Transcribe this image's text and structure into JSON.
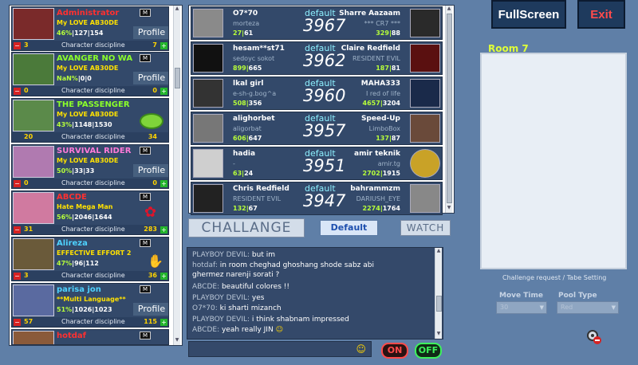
{
  "players": [
    {
      "name": "Administrator",
      "name_color": "#ff3030",
      "subtitle": "My LOVE AB30DE",
      "percent": "46%",
      "wins": "127",
      "total": "154",
      "level": "3",
      "discipline_label": "Character discipline",
      "discipline": "7",
      "profile_label": "Profile",
      "badge": "M"
    },
    {
      "name": "AVANGER NO WA",
      "name_color": "#8bff2a",
      "subtitle": "My LOVE AB30DE",
      "percent": "NaN%",
      "wins": "0",
      "total": "0",
      "level": "0",
      "discipline_label": "Character discipline",
      "discipline": "0",
      "profile_label": "Profile",
      "badge": "M"
    },
    {
      "name": "THE PASSENGER",
      "name_color": "#8bff2a",
      "subtitle": "My LOVE AB30DE",
      "percent": "43%",
      "wins": "1148",
      "total": "1530",
      "level": "20",
      "discipline_label": "Character discipline",
      "discipline": "34",
      "profile_label": "",
      "badge": ""
    },
    {
      "name": "SURVIVAL RIDER",
      "name_color": "#ff7ad9",
      "subtitle": "My LOVE AB30DE",
      "percent": "50%",
      "wins": "33",
      "total": "33",
      "level": "0",
      "discipline_label": "Character discipline",
      "discipline": "0",
      "profile_label": "Profile",
      "badge": "M"
    },
    {
      "name": "ABCDE",
      "name_color": "#ff3030",
      "subtitle": "Hate Mega Man",
      "percent": "56%",
      "wins": "2046",
      "total": "1644",
      "level": "31",
      "discipline_label": "Character discipline",
      "discipline": "283",
      "profile_label": "",
      "badge": "M"
    },
    {
      "name": "Alireza",
      "name_color": "#4fd2ff",
      "subtitle": "EFFECTIVE EFFORT 2",
      "percent": "47%",
      "wins": "96",
      "total": "112",
      "level": "3",
      "discipline_label": "Character discipline",
      "discipline": "36",
      "profile_label": "",
      "badge": "M"
    },
    {
      "name": "parisa jon",
      "name_color": "#4fd2ff",
      "subtitle": "**Multi Language**",
      "percent": "51%",
      "wins": "1026",
      "total": "1023",
      "level": "57",
      "discipline_label": "Character discipline",
      "discipline": "115",
      "profile_label": "Profile",
      "badge": "M"
    },
    {
      "name": "hotdaf",
      "name_color": "#ff3030",
      "subtitle": "",
      "percent": "",
      "wins": "",
      "total": "",
      "level": "",
      "discipline_label": "",
      "discipline": "",
      "profile_label": "",
      "badge": "M"
    }
  ],
  "tables": [
    {
      "a_name": "O7*70",
      "a_sub": "morteza",
      "a_w": "27",
      "a_t": "61",
      "mode": "default",
      "code": "3967",
      "b_name": "Sharre Aazaam",
      "b_sub": "*** CR7 ***",
      "b_w": "329",
      "b_t": "88"
    },
    {
      "a_name": "hesam**st71",
      "a_sub": "sedoyc sokot",
      "a_w": "899",
      "a_t": "665",
      "mode": "default",
      "code": "3962",
      "b_name": "Claire Redfield",
      "b_sub": "RESIDENT EVIL",
      "b_w": "187",
      "b_t": "81"
    },
    {
      "a_name": "lkal girl",
      "a_sub": "e-sh-g.bog^a",
      "a_w": "508",
      "a_t": "356",
      "mode": "default",
      "code": "3960",
      "b_name": "MAHA333",
      "b_sub": "I red of life",
      "b_w": "4657",
      "b_t": "3204"
    },
    {
      "a_name": "alighorbet",
      "a_sub": "aligorbat",
      "a_w": "606",
      "a_t": "647",
      "mode": "default",
      "code": "3957",
      "b_name": "Speed-Up",
      "b_sub": "LimboBox",
      "b_w": "137",
      "b_t": "87"
    },
    {
      "a_name": "hadia",
      "a_sub": "-",
      "a_w": "63",
      "a_t": "24",
      "mode": "default",
      "code": "3951",
      "b_name": "amir teknik",
      "b_sub": "amir.tg",
      "b_w": "2702",
      "b_t": "1915"
    },
    {
      "a_name": "Chris Redfield",
      "a_sub": "RESIDENT EVIL",
      "a_w": "132",
      "a_t": "67",
      "mode": "default",
      "code": "3947",
      "b_name": "bahrammzm",
      "b_sub": "DARIUSH_EYE",
      "b_w": "2274",
      "b_t": "1764"
    }
  ],
  "buttons": {
    "challenge": "CHALLANGE",
    "default": "Default",
    "watch": "WATCH",
    "fullscreen": "FullScreen",
    "exit": "Exit",
    "on": "ON",
    "off": "OFF"
  },
  "chat": [
    {
      "who": "PLAYBOY DEVIL:",
      "msg": " but im"
    },
    {
      "who": "hotdaf:",
      "msg": " in room cheghad ghoshang shode sabz abi"
    },
    {
      "who": "",
      "msg": "ghermez narenji sorati ?"
    },
    {
      "who": "ABCDE:",
      "msg": " beautiful colores !!"
    },
    {
      "who": "PLAYBOY DEVIL:",
      "msg": " yes"
    },
    {
      "who": "O7*70:",
      "msg": " ki sharti mizanch"
    },
    {
      "who": "PLAYBOY DEVIL:",
      "msg": " i think shabnam impressed"
    },
    {
      "who": "ABCDE:",
      "msg": " yeah really JIN"
    }
  ],
  "room": {
    "title": "Room 7",
    "challenge_settings": "Challenge request / Tabe Setting",
    "move_time_label": "Move Time",
    "move_time_value": "30",
    "pool_type_label": "Pool Type",
    "pool_type_value": "Red"
  },
  "colors": {
    "background": "#5f7fa7",
    "panel": "#33496a",
    "accent_green": "#b7ff3a",
    "mode_cyan": "#8df0ff"
  }
}
